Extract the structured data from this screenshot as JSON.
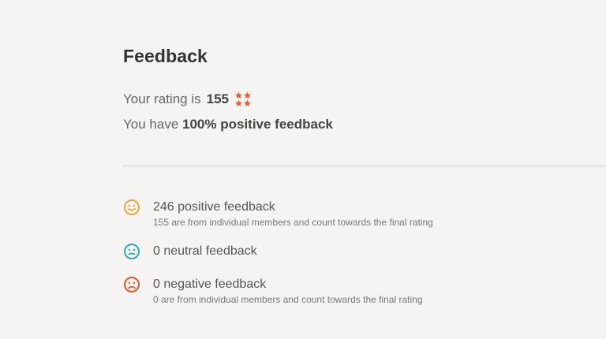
{
  "header": {
    "title": "Feedback"
  },
  "rating": {
    "prefix": "Your rating is",
    "value": "155",
    "icon": "stars-icon"
  },
  "positive_summary": {
    "prefix": "You have",
    "value": "100% positive feedback"
  },
  "feedback_items": [
    {
      "icon": "smile-icon",
      "color": "#e8a83a",
      "label": "246 positive feedback",
      "sub": "155 are from individual members and count towards the final rating"
    },
    {
      "icon": "neutral-face-icon",
      "color": "#2fa9b8",
      "label": "0 neutral feedback",
      "sub": ""
    },
    {
      "icon": "sad-face-icon",
      "color": "#e05a2b",
      "label": "0 negative feedback",
      "sub": "0 are from individual members and count towards the final rating"
    }
  ],
  "colors": {
    "background": "#f5f4f2",
    "star": "#e05a2b",
    "divider": "#cfcdca"
  }
}
